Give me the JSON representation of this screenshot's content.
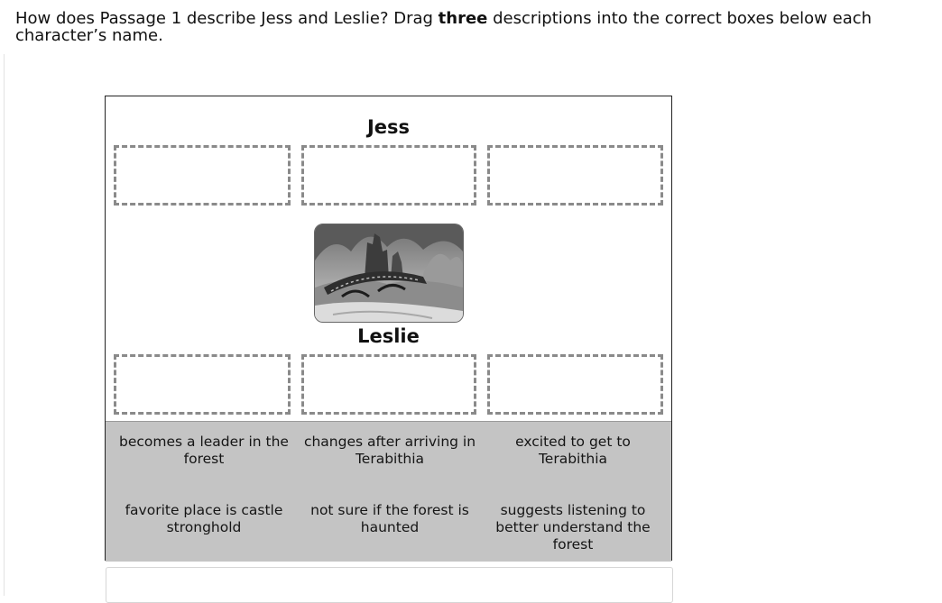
{
  "question": {
    "text_before": "How does Passage 1 describe Jess and Leslie? Drag ",
    "emphasis": "three",
    "text_after": " descriptions into the correct boxes below each character’s name."
  },
  "characters": {
    "first": "Jess",
    "second": "Leslie"
  },
  "options": [
    "becomes a leader in the forest",
    "changes after arriving  in Terabithia",
    "excited to get to Terabithia",
    "favorite place is castle stronghold",
    "not sure if the forest is haunted",
    "suggests listening to better understand the forest"
  ],
  "image": {
    "icon": "bridge-illustration-icon"
  }
}
